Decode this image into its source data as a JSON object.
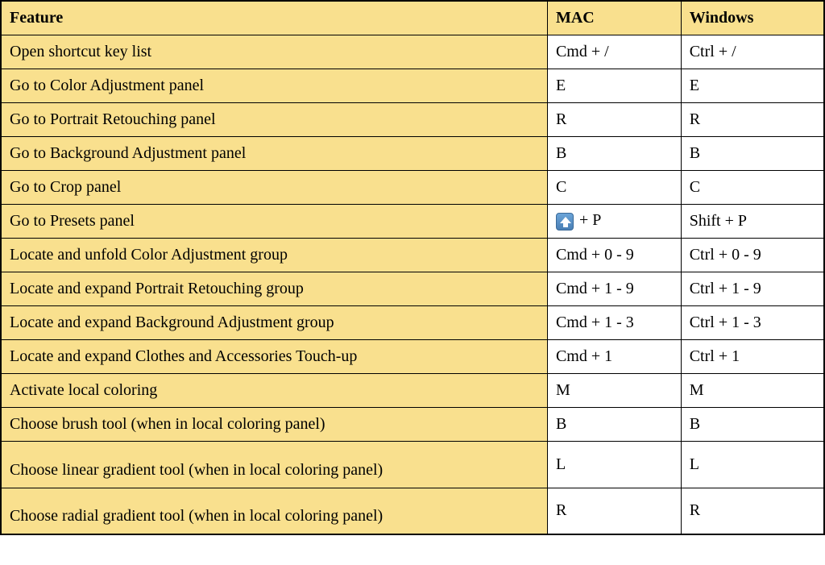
{
  "headers": {
    "feature": "Feature",
    "mac": "MAC",
    "windows": "Windows"
  },
  "rows": [
    {
      "feature": "Open shortcut key list",
      "mac": "Cmd + /",
      "win": "Ctrl + /",
      "tall": false,
      "mac_icon": null
    },
    {
      "feature": "Go to Color Adjustment panel",
      "mac": "E",
      "win": "E",
      "tall": false,
      "mac_icon": null
    },
    {
      "feature": "Go to Portrait Retouching panel",
      "mac": "R",
      "win": "R",
      "tall": false,
      "mac_icon": null
    },
    {
      "feature": "Go to Background Adjustment panel",
      "mac": "B",
      "win": "B",
      "tall": false,
      "mac_icon": null
    },
    {
      "feature": "Go to Crop panel",
      "mac": "C",
      "win": "C",
      "tall": false,
      "mac_icon": null
    },
    {
      "feature": "Go to Presets panel",
      "mac": " + P",
      "win": "Shift + P",
      "tall": false,
      "mac_icon": "shift"
    },
    {
      "feature": "Locate and unfold Color Adjustment group",
      "mac": "Cmd + 0 - 9",
      "win": "Ctrl + 0 - 9",
      "tall": false,
      "mac_icon": null
    },
    {
      "feature": "Locate and expand Portrait Retouching group",
      "mac": "Cmd + 1 - 9",
      "win": "Ctrl + 1 - 9",
      "tall": false,
      "mac_icon": null
    },
    {
      "feature": "Locate and expand Background Adjustment group",
      "mac": "Cmd + 1 - 3",
      "win": "Ctrl + 1 - 3",
      "tall": false,
      "mac_icon": null
    },
    {
      "feature": "Locate and expand Clothes and Accessories Touch-up",
      "mac": "Cmd + 1",
      "win": "Ctrl + 1",
      "tall": false,
      "mac_icon": null
    },
    {
      "feature": "Activate local coloring",
      "mac": "M",
      "win": "M",
      "tall": false,
      "mac_icon": null
    },
    {
      "feature": "Choose brush tool (when in local coloring panel)",
      "mac": "B",
      "win": "B",
      "tall": false,
      "mac_icon": null
    },
    {
      "feature": "Choose linear gradient tool (when in local coloring panel)",
      "mac": "L",
      "win": "L",
      "tall": true,
      "mac_icon": null
    },
    {
      "feature": "Choose radial gradient tool (when in local coloring panel)",
      "mac": "R",
      "win": "R",
      "tall": true,
      "mac_icon": null
    }
  ]
}
